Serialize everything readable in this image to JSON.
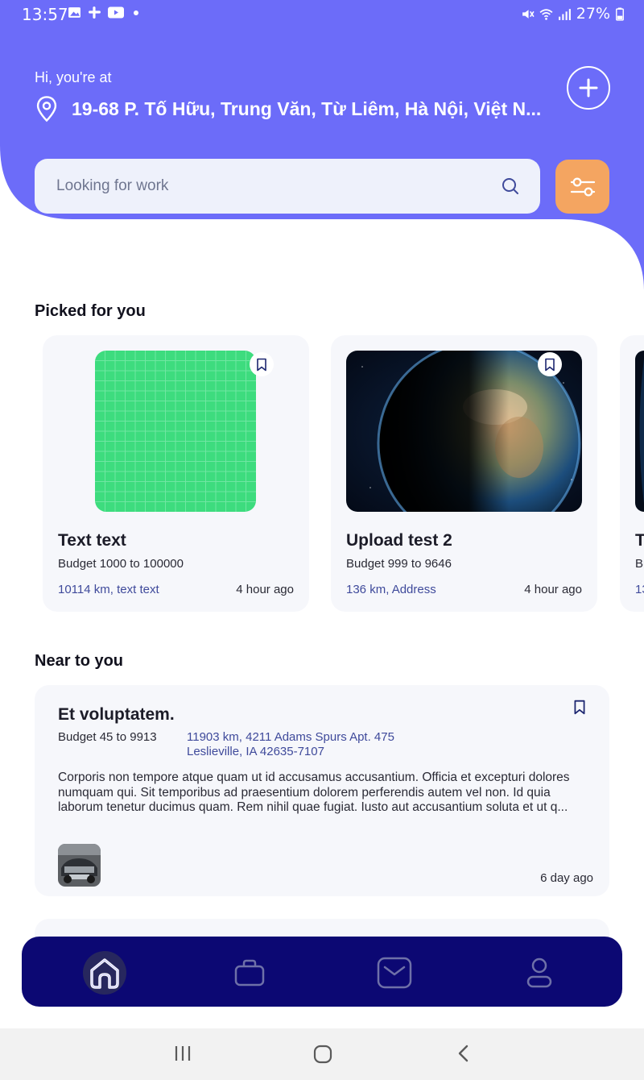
{
  "status_bar": {
    "time": "13:57",
    "battery": "27%"
  },
  "header": {
    "greeting": "Hi, you're at",
    "address": "19-68 P. Tố Hữu, Trung Văn, Từ Liêm, Hà Nội, Việt N...",
    "accent_color": "#6c6cf9"
  },
  "search": {
    "placeholder": "Looking for work"
  },
  "sections": {
    "picked": "Picked for you",
    "near": "Near to you"
  },
  "picked_cards": [
    {
      "title": "Text text",
      "budget": "Budget 1000 to 100000",
      "distance": "10114 km, text text",
      "time": "4 hour ago",
      "image": "green-grid"
    },
    {
      "title": "Upload test 2",
      "budget": "Budget 999 to 9646",
      "distance": "136 km, Address",
      "time": "4 hour ago",
      "image": "earth"
    },
    {
      "title": "T",
      "budget": "Bu",
      "distance": "13",
      "time": "",
      "image": "earth"
    }
  ],
  "near_card": {
    "title": "Et voluptatem.",
    "budget": "Budget 45 to 9913",
    "address_line1": "11903 km, 4211 Adams Spurs Apt. 475",
    "address_line2": "Leslieville, IA 42635-7107",
    "description": "Corporis non tempore atque quam ut id accusamus accusantium. Officia et excepturi dolores numquam qui. Sit temporibus ad praesentium dolorem perferendis autem vel non. Id quia laborum tenetur ducimus quam. Rem nihil quae fugiat. Iusto aut accusantium soluta et ut q...",
    "time": "6 day ago"
  },
  "bottom_nav": {
    "items": [
      "home-icon",
      "briefcase-icon",
      "mail-icon",
      "profile-icon"
    ],
    "active": "home-icon",
    "background": "#0c0873"
  },
  "system_nav": [
    "recent-apps-icon",
    "home-circle-icon",
    "back-icon"
  ]
}
